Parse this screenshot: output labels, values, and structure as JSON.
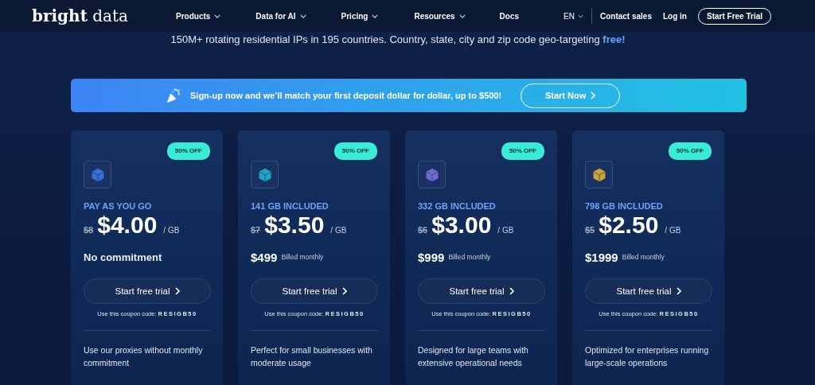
{
  "nav": {
    "logo_bold": "bright",
    "logo_light": "data",
    "menu": [
      {
        "label": "Products",
        "dropdown": true
      },
      {
        "label": "Data for AI",
        "dropdown": true
      },
      {
        "label": "Pricing",
        "dropdown": true
      },
      {
        "label": "Resources",
        "dropdown": true
      },
      {
        "label": "Docs",
        "dropdown": false
      }
    ],
    "language": "EN",
    "contact": "Contact sales",
    "login": "Log in",
    "cta": "Start Free Trial"
  },
  "subtitle": "150M+ rotating residential IPs in 195 countries. Country, state, city and zip code geo-targeting **free!**",
  "banner": {
    "text": "Sign-up now and we’ll match your first deposit dollar for dollar, up to $500!",
    "button": "Start Now"
  },
  "plans": [
    {
      "badge": "50% OFF",
      "color": "#3b6fd8",
      "title": "PAY AS YOU GO",
      "old_price": "$8",
      "price": "$4.00",
      "unit": "/ GB",
      "kind": "commitment",
      "commitment": "No commitment",
      "button": "Start free trial",
      "coupon": "Use this coupon code: **RESIGB50**",
      "description": "Use our proxies without monthly commitment"
    },
    {
      "badge": "50% OFF",
      "color": "#1fa3c9",
      "title": "141 GB INCLUDED",
      "old_price": "$7",
      "price": "$3.50",
      "unit": "/ GB",
      "kind": "billed",
      "amount": "$499",
      "note": "Billed monthly",
      "button": "Start free trial",
      "coupon": "Use this coupon code: **RESIGB50**",
      "description": "Perfect for small businesses with moderate usage"
    },
    {
      "badge": "50% OFF",
      "color": "#6f6cc9",
      "title": "332 GB INCLUDED",
      "old_price": "$6",
      "price": "$3.00",
      "unit": "/ GB",
      "kind": "billed",
      "amount": "$999",
      "note": "Billed monthly",
      "button": "Start free trial",
      "coupon": "Use this coupon code: **RESIGB50**",
      "description": "Designed for large teams with extensive operational needs"
    },
    {
      "badge": "50% OFF",
      "color": "#c9a53c",
      "title": "798 GB INCLUDED",
      "old_price": "$5",
      "price": "$2.50",
      "unit": "/ GB",
      "kind": "billed",
      "amount": "$1999",
      "note": "Billed monthly",
      "button": "Start free trial",
      "coupon": "Use this coupon code: **RESIGB50**",
      "description": "Optimized for enterprises running large-scale operations"
    }
  ]
}
